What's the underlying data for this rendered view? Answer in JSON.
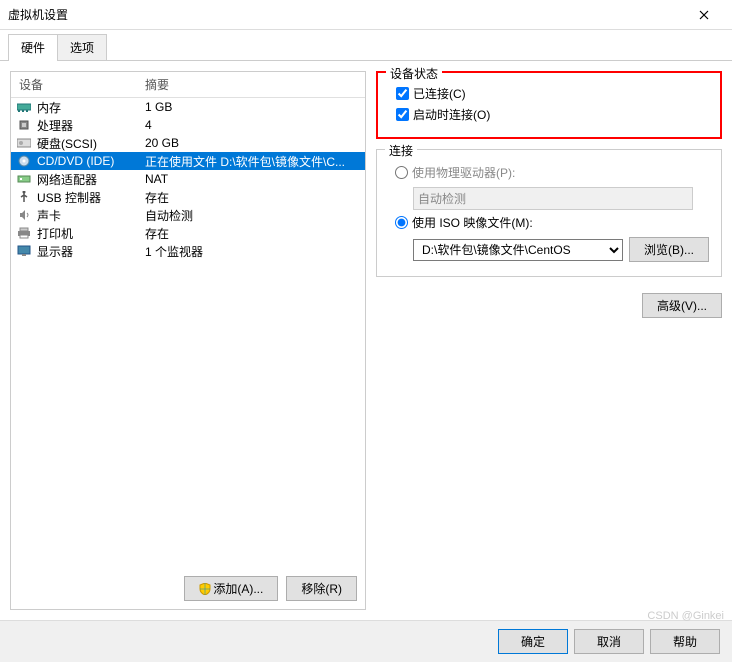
{
  "window": {
    "title": "虚拟机设置"
  },
  "tabs": {
    "hardware": "硬件",
    "options": "选项"
  },
  "list": {
    "col_device": "设备",
    "col_summary": "摘要",
    "items": [
      {
        "label": "内存",
        "summary": "1 GB",
        "icon": "memory"
      },
      {
        "label": "处理器",
        "summary": "4",
        "icon": "cpu"
      },
      {
        "label": "硬盘(SCSI)",
        "summary": "20 GB",
        "icon": "disk"
      },
      {
        "label": "CD/DVD (IDE)",
        "summary": "正在使用文件 D:\\软件包\\镜像文件\\C...",
        "icon": "cd",
        "selected": true
      },
      {
        "label": "网络适配器",
        "summary": "NAT",
        "icon": "net"
      },
      {
        "label": "USB 控制器",
        "summary": "存在",
        "icon": "usb"
      },
      {
        "label": "声卡",
        "summary": "自动检测",
        "icon": "sound"
      },
      {
        "label": "打印机",
        "summary": "存在",
        "icon": "printer"
      },
      {
        "label": "显示器",
        "summary": "1 个监视器",
        "icon": "display"
      }
    ]
  },
  "left_buttons": {
    "add": "添加(A)...",
    "remove": "移除(R)"
  },
  "state_group": {
    "title": "设备状态",
    "connected": "已连接(C)",
    "connect_on": "启动时连接(O)"
  },
  "conn_group": {
    "title": "连接",
    "physical": "使用物理驱动器(P):",
    "auto_detect": "自动检测",
    "iso": "使用 ISO 映像文件(M):",
    "iso_path": "D:\\软件包\\镜像文件\\CentOS",
    "browse": "浏览(B)..."
  },
  "advanced": "高级(V)...",
  "footer": {
    "ok": "确定",
    "cancel": "取消",
    "help": "帮助"
  },
  "watermark": "CSDN @Ginkei"
}
